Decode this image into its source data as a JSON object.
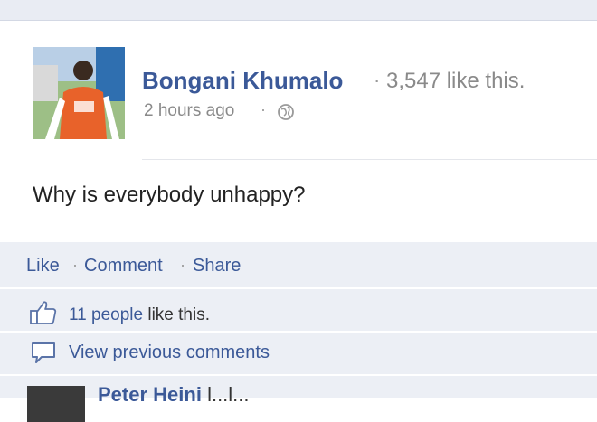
{
  "post": {
    "author": "Bongani Khumalo",
    "likes_inline": "3,547 like this.",
    "timestamp": "2 hours ago",
    "privacy_icon": "globe-icon",
    "status_text": "Why is everybody unhappy?"
  },
  "actions": {
    "like": "Like",
    "comment": "Comment",
    "share": "Share"
  },
  "likes_row": {
    "count_text": "11 people",
    "suffix": " like this.",
    "icon": "thumbs-up-icon"
  },
  "comments": {
    "view_previous": "View previous comments",
    "icon": "comment-icon",
    "first_commenter_partial": "Peter Heini",
    "first_comment_partial": "l...l..."
  },
  "colors": {
    "link": "#3b5998",
    "muted": "#8a8a8a",
    "panel": "#eceff5"
  }
}
